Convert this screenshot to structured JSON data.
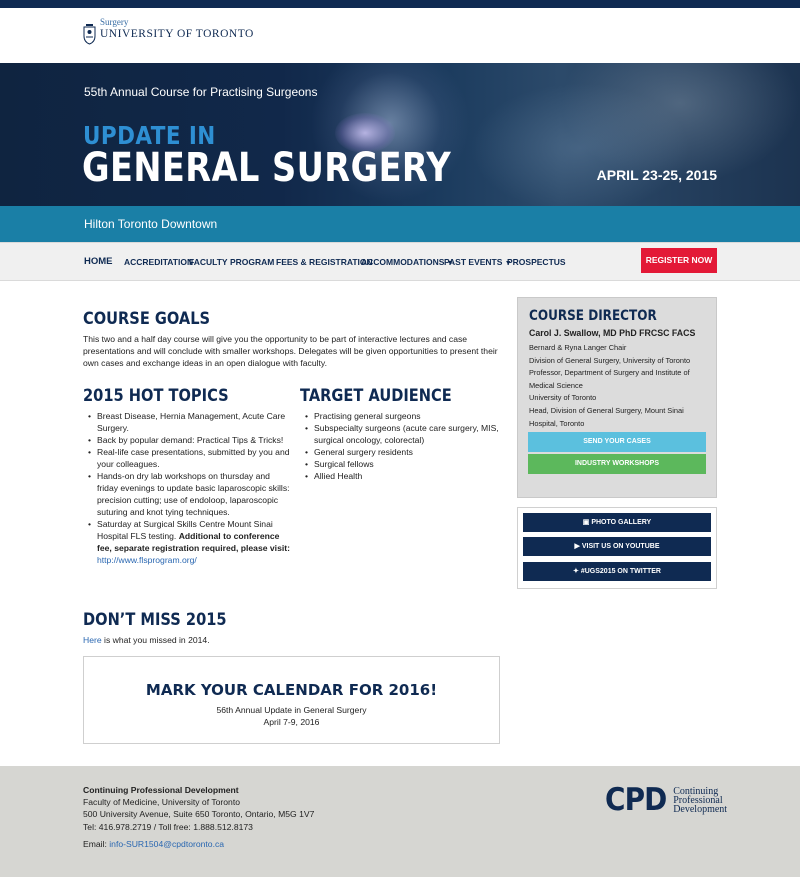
{
  "header": {
    "logo_sub": "Surgery",
    "logo_main": "UNIVERSITY OF TORONTO"
  },
  "hero": {
    "subtitle": "55th Annual Course for Practising Surgeons",
    "title_line1": "UPDATE IN",
    "title_line2": "GENERAL SURGERY",
    "date": "APRIL 23-25, 2015",
    "venue": "Hilton Toronto Downtown"
  },
  "nav": {
    "items": [
      {
        "label": "HOME"
      },
      {
        "label": "ACCREDITATION"
      },
      {
        "label": "FACULTY"
      },
      {
        "label": "PROGRAM"
      },
      {
        "label": "FEES & REGISTRATION"
      },
      {
        "label": "ACCOMMODATIONS"
      },
      {
        "label": "PAST EVENTS"
      },
      {
        "label": "PROSPECTUS"
      }
    ],
    "register_label": "REGISTER NOW"
  },
  "goals": {
    "heading": "COURSE GOALS",
    "text": "This two and a half day course will give you the opportunity to be part of interactive lectures and case presentations and will conclude with smaller workshops. Delegates will be given opportunities to present their own cases and exchange ideas in an open dialogue with faculty."
  },
  "hot_topics": {
    "heading": "2015 HOT TOPICS",
    "items": [
      "Breast Disease, Hernia Management, Acute Care Surgery.",
      "Back by popular demand: Practical Tips & Tricks!",
      "Real-life case presentations, submitted by you and your colleagues.",
      "Hands-on dry lab workshops on thursday and friday evenings to update basic laparoscopic skills: precision cutting; use of endoloop, laparoscopic suturing and knot tying techniques."
    ],
    "last_item_text": "Saturday at Surgical Skills Centre Mount Sinai Hospital FLS testing. ",
    "last_item_bold": "Additional to conference fee, separate registration required, please visit:",
    "last_item_link": "http://www.flsprogram.org/"
  },
  "audience": {
    "heading": "TARGET AUDIENCE",
    "items": [
      "Practising general surgeons",
      "Subspecialty surgeons (acute care surgery, MIS, surgical oncology, colorectal)",
      "General surgery residents",
      "Surgical fellows",
      "Allied Health"
    ]
  },
  "dont_miss": {
    "heading": "DON’T MISS 2015",
    "link": "Here",
    "text": " is what you missed in 2014."
  },
  "calendar": {
    "title": "MARK YOUR CALENDAR FOR 2016!",
    "line1": "56th Annual Update in General Surgery",
    "line2": "April 7-9, 2016"
  },
  "director": {
    "heading": "COURSE DIRECTOR",
    "name": "Carol J. Swallow, MD PhD FRCSC FACS",
    "lines": [
      "Bernard & Ryna Langer Chair",
      "Division of General Surgery, University of Toronto",
      "Professor, Department of Surgery and Institute of Medical Science",
      "University of Toronto",
      "Head, Division of General Surgery, Mount Sinai Hospital, Toronto"
    ],
    "btn_cases": "SEND YOUR CASES",
    "btn_workshops": "INDUSTRY WORKSHOPS"
  },
  "social": {
    "gallery": "PHOTO GALLERY",
    "youtube": "VISIT US ON YOUTUBE",
    "twitter": "#UGS2015 ON TWITTER"
  },
  "footer": {
    "org": "Continuing Professional Development",
    "faculty": "Faculty of Medicine, University of Toronto",
    "address": "500 University Avenue, Suite 650 Toronto, Ontario, M5G 1V7",
    "phone": "Tel: 416.978.2719 / Toll free: 1.888.512.8173",
    "email_label": "Email: ",
    "email": "info-SUR1504@cpdtoronto.ca",
    "cpd_big": "CPD",
    "cpd_line1": "Continuing",
    "cpd_line2": "Professional",
    "cpd_line3": "Development"
  },
  "colors": {
    "navy": "#0f2a52",
    "teal": "#1a7fa6",
    "accent_blue": "#2e8fd3",
    "register_red": "#e31937",
    "button_light_blue": "#5bc0de",
    "button_green": "#5cb85c"
  }
}
